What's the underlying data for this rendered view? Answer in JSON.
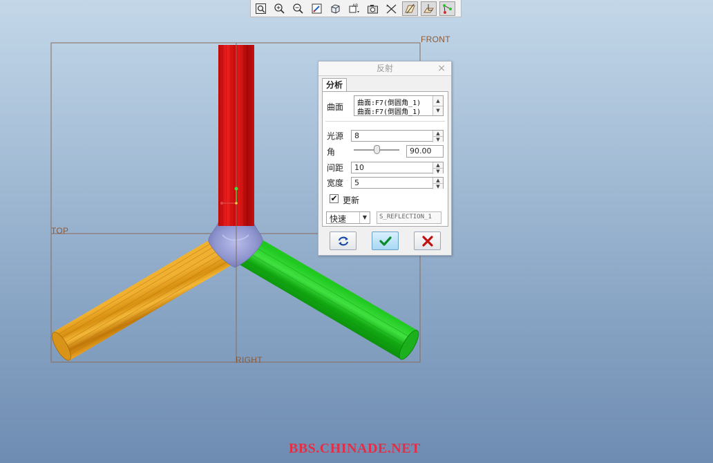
{
  "toolbar": {
    "buttons": [
      {
        "icon": "zoom-fit-icon"
      },
      {
        "icon": "zoom-in-icon"
      },
      {
        "icon": "zoom-out-icon"
      },
      {
        "icon": "repaint-icon"
      },
      {
        "icon": "view-orient-icon"
      },
      {
        "icon": "saved-views-icon"
      },
      {
        "icon": "display-style-icon"
      },
      {
        "icon": "datum-plane-toggle-icon"
      },
      {
        "icon": "datum-axis-toggle-icon"
      },
      {
        "icon": "datum-csys-toggle-icon"
      },
      {
        "icon": "datum-point-toggle-icon"
      }
    ]
  },
  "viewport": {
    "datum_front": "FRONT",
    "datum_top": "TOP",
    "datum_right": "RIGHT",
    "colors": {
      "red_pipe": "#d81010",
      "orange_pipe": "#e8a010",
      "green_pipe": "#18b818",
      "fillet": "#9aa0d8",
      "datum": "#8a5a3a"
    }
  },
  "dialog": {
    "title": "反射",
    "close": "×",
    "tab": "分析",
    "surface_label": "曲面",
    "surface_refs": [
      "曲面:F7(倒圆角_1)",
      "曲面:F7(倒圆角_1)"
    ],
    "light_label": "光源",
    "light_value": "8",
    "angle_label": "角",
    "angle_value": "90.00",
    "angle_slider": 0.5,
    "spacing_label": "间距",
    "spacing_value": "10",
    "width_label": "宽度",
    "width_value": "5",
    "update_label": "更新",
    "update_checked": true,
    "mode_value": "快速",
    "name_value": "S_REFLECTION_1",
    "buttons": {
      "repeat": "repeat-icon",
      "ok": "checkmark-icon",
      "cancel": "x-icon"
    }
  },
  "watermark": "BBS.CHINADE.NET"
}
